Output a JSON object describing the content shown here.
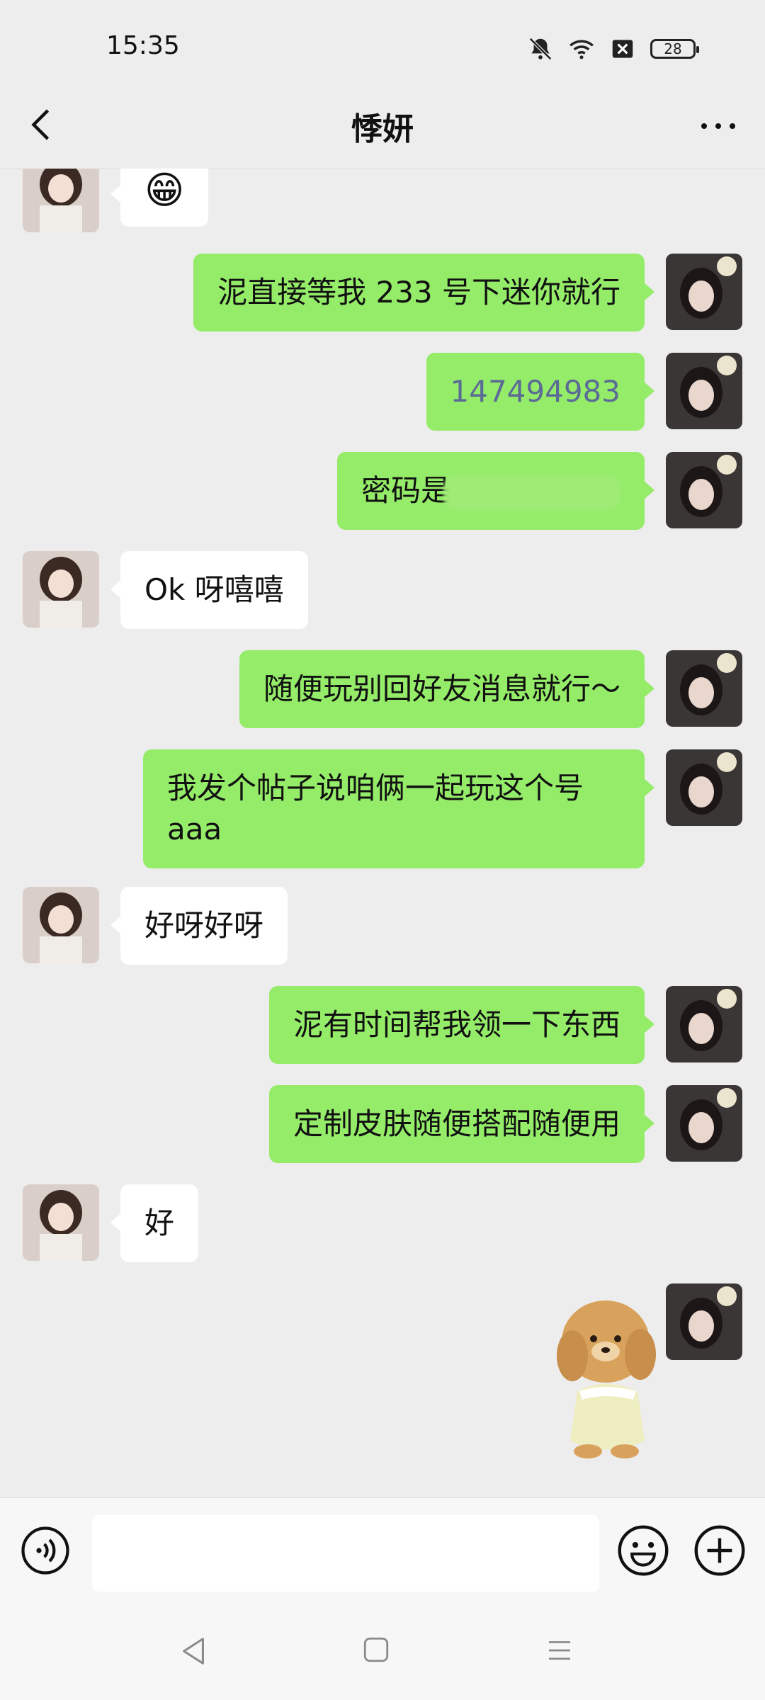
{
  "status_bar": {
    "time": "15:35",
    "battery": "28",
    "icons": [
      "bell-off-icon",
      "wifi-icon",
      "sim-x-icon",
      "battery-icon"
    ]
  },
  "header": {
    "title": "悸妍",
    "back_icon": "chevron-left-icon",
    "more_icon": "more-dots-icon"
  },
  "messages": [
    {
      "side": "left",
      "type": "emoji",
      "text": "😁"
    },
    {
      "side": "right",
      "type": "text",
      "text": "泥直接等我 233 号下迷你就行"
    },
    {
      "side": "right",
      "type": "text",
      "text": "147494983"
    },
    {
      "side": "right",
      "type": "text",
      "text": "密码是"
    },
    {
      "side": "left",
      "type": "text",
      "text": "Ok 呀嘻嘻"
    },
    {
      "side": "right",
      "type": "text",
      "text": "随便玩别回好友消息就行～"
    },
    {
      "side": "right",
      "type": "text",
      "text": "我发个帖子说咱俩一起玩这个号aaa"
    },
    {
      "side": "left",
      "type": "text",
      "text": "好呀好呀"
    },
    {
      "side": "right",
      "type": "text",
      "text": "泥有时间帮我领一下东西"
    },
    {
      "side": "right",
      "type": "text",
      "text": "定制皮肤随便搭配随便用"
    },
    {
      "side": "left",
      "type": "text",
      "text": "好"
    },
    {
      "side": "right",
      "type": "sticker",
      "text": ""
    }
  ],
  "colors": {
    "background": "#ededed",
    "bubble_self": "#95ec69",
    "bubble_other": "#ffffff",
    "link_text": "#5b6b96"
  },
  "input_bar": {
    "voice_icon": "voice-icon",
    "emoji_icon": "emoji-icon",
    "plus_icon": "plus-icon",
    "input_value": ""
  },
  "nav_bar": {
    "icons": [
      "nav-back-icon",
      "nav-home-icon",
      "nav-menu-icon"
    ]
  }
}
